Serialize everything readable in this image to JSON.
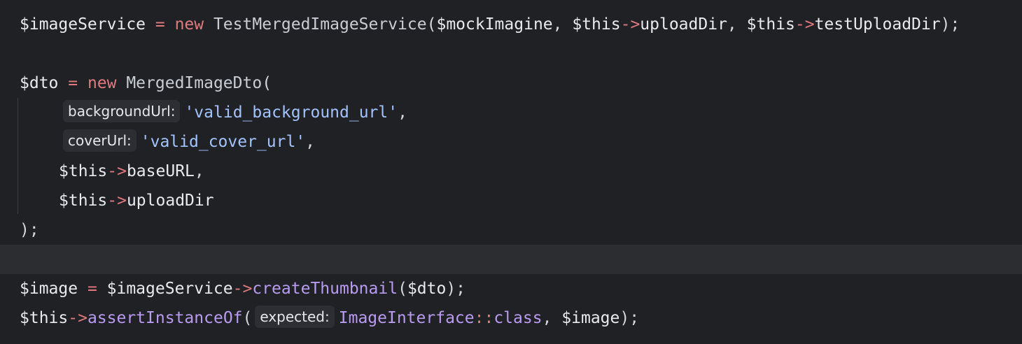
{
  "code": {
    "line1": {
      "var": "$imageService",
      "eq": " = ",
      "kw": "new",
      "cls": " TestMergedImageService",
      "open": "(",
      "arg1": "$mockImagine",
      "comma1": ", ",
      "this1": "$this",
      "arrow1": "->",
      "prop1": "uploadDir",
      "comma2": ", ",
      "this2": "$this",
      "arrow2": "->",
      "prop2": "testUploadDir",
      "close": ");"
    },
    "line2": {
      "var": "$dto",
      "eq": " = ",
      "kw": "new",
      "cls": " MergedImageDto",
      "open": "("
    },
    "line3": {
      "hint": "backgroundUrl:",
      "str": "'valid_background_url'",
      "comma": ","
    },
    "line4": {
      "hint": "coverUrl:",
      "str": "'valid_cover_url'",
      "comma": ","
    },
    "line5": {
      "this": "$this",
      "arrow": "->",
      "prop": "baseURL",
      "comma": ","
    },
    "line6": {
      "this": "$this",
      "arrow": "->",
      "prop": "uploadDir"
    },
    "line7": {
      "close": ");"
    },
    "line8": {
      "var": "$image",
      "eq": " = ",
      "svc": "$imageService",
      "arrow": "->",
      "method": "createThumbnail",
      "open": "(",
      "arg": "$dto",
      "close": ");"
    },
    "line9": {
      "this": "$this",
      "arrow": "->",
      "method": "assertInstanceOf",
      "open": "(",
      "hint": "expected:",
      "cls": "ImageInterface",
      "scope": "::",
      "kwclass": "class",
      "comma": ", ",
      "arg": "$image",
      "close": ");"
    }
  },
  "colors": {
    "background": "#1f2124",
    "current_line": "#2b2d31",
    "keyword": "#e07a7f",
    "string": "#a3c3ff",
    "method": "#b99bf2",
    "variable": "#e9eaed"
  }
}
